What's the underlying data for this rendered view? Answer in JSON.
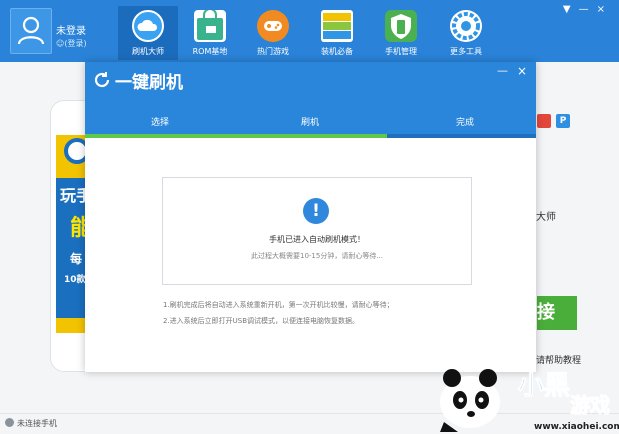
{
  "user": {
    "name": "未登录",
    "login_link": "(登录)"
  },
  "nav": [
    {
      "label": "刷机大师",
      "icon": "cloud-icon",
      "color": "#3aa2f0"
    },
    {
      "label": "ROM基地",
      "icon": "shopping-bag-icon",
      "color": "#38b38e"
    },
    {
      "label": "热门游戏",
      "icon": "gamepad-icon",
      "color": "#f28a22"
    },
    {
      "label": "装机必备",
      "icon": "apps-icon",
      "color": "#8cc63f"
    },
    {
      "label": "手机管理",
      "icon": "shield-icon",
      "color": "#4bb04f"
    },
    {
      "label": "更多工具",
      "icon": "gear-icon",
      "color": "#2f96e6"
    }
  ],
  "window_controls": [
    "▼",
    "—",
    "×"
  ],
  "promo": {
    "line1": "玩手",
    "line2": "能",
    "line3": "每",
    "line4": "10款"
  },
  "right_panel": {
    "master_text": "大师",
    "connect_button": "接",
    "help_link": "请帮助教程"
  },
  "status": {
    "text": "未连接手机"
  },
  "dialog": {
    "title": "一键刷机",
    "minimize": "—",
    "close": "×",
    "steps": [
      "选择",
      "刷机",
      "完成"
    ],
    "progress_fraction": 0.67,
    "message_title": "手机已进入自动刷机模式！",
    "message_sub": "此过程大概需要10-15分钟，请耐心等待...",
    "notes": [
      "1.刷机完成后将自动进入系统重新开机，第一次开机比较慢，请耐心等待；",
      "2.进入系统后立即打开USB调试模式，以便连接电脑恢复数据。"
    ]
  },
  "watermark": {
    "text1": "小黑",
    "text2": "游戏",
    "url": "www.xiaohei.com"
  },
  "colors": {
    "primary": "#2a83d8",
    "success": "#4aae3a",
    "alert": "#2f88dc"
  }
}
